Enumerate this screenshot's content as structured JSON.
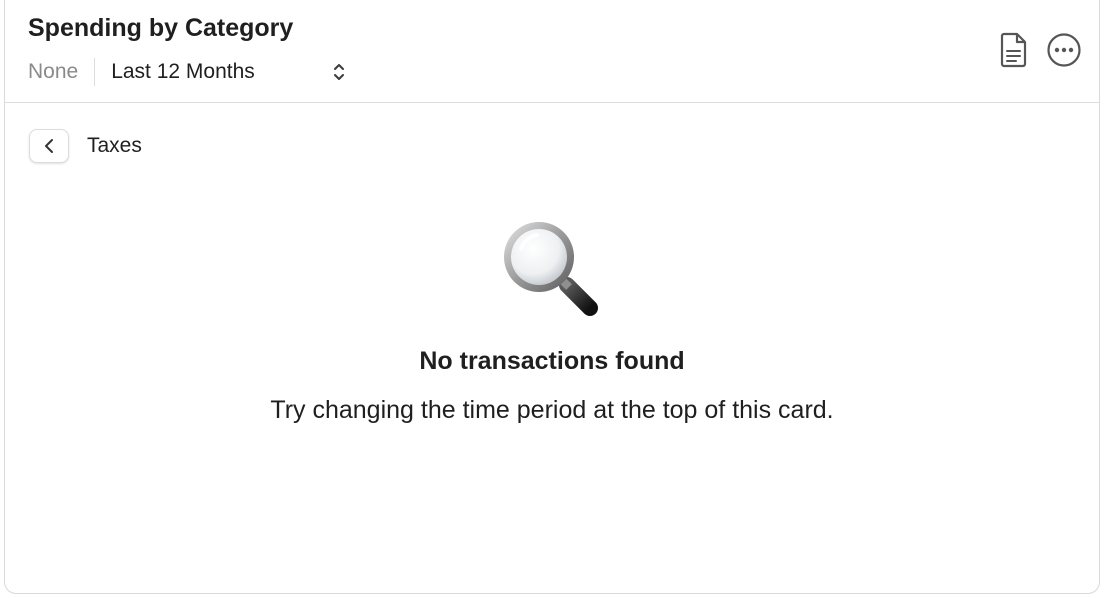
{
  "card": {
    "title": "Spending by Category",
    "filter": {
      "selection": "None",
      "period": "Last 12 Months"
    },
    "icons": {
      "document": "document-icon",
      "more": "ellipsis-circle-icon",
      "sort": "chevron-up-down-icon"
    }
  },
  "breadcrumb": {
    "back_icon": "chevron-left-icon",
    "label": "Taxes"
  },
  "empty_state": {
    "icon": "magnifying-glass-icon",
    "title": "No transactions found",
    "hint": "Try changing the time period at the top of this card."
  },
  "colors": {
    "text": "#1f1f1f",
    "muted": "#8a8a8a",
    "border": "#dcdcdc"
  }
}
